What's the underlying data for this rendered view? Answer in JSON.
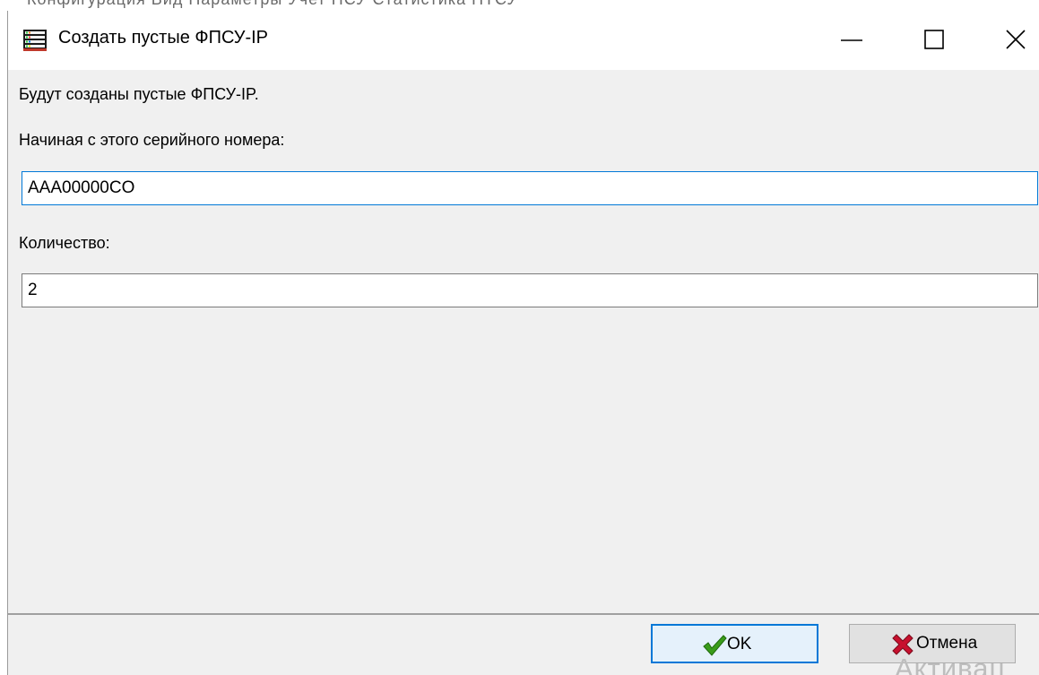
{
  "background": {
    "menu_strip_text": "Конфигурация   Вид   Параметры   Учет ПСУ   Статистика ПТСУ"
  },
  "dialog": {
    "title": "Создать пустые ФПСУ-IP",
    "icon": "server-rack-icon",
    "caption_buttons": [
      "minimize-icon",
      "maximize-icon",
      "close-icon"
    ],
    "info_text": "Будут созданы пустые ФПСУ-IP.",
    "serial_label": "Начиная с этого серийного номера:",
    "serial_value": "AAA00000CO",
    "quantity_label": "Количество:",
    "quantity_value": "2",
    "ok_label": "OK",
    "ok_icon": "checkmark-icon",
    "cancel_label": "Отмена",
    "cancel_icon": "red-x-icon"
  },
  "watermark": "Активац",
  "colors": {
    "accent": "#0078d7",
    "ok_check": "#3a9c1a",
    "cancel_x": "#c8102e",
    "dialog_bg": "#f0f0f0"
  }
}
